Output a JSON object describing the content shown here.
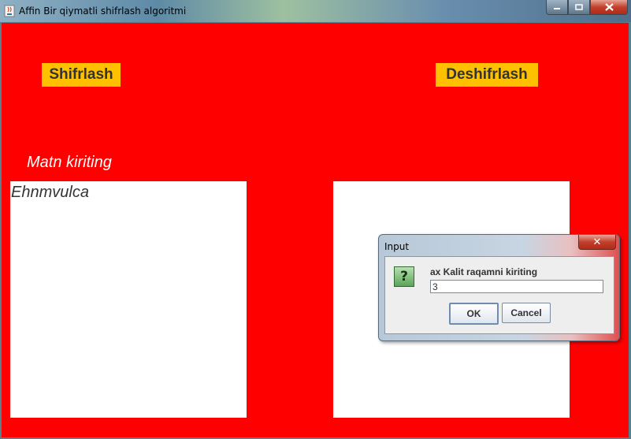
{
  "window": {
    "title": "Affin Bir qiymatli shifrlash algoritmi",
    "icon": "java-cup-icon",
    "controls": [
      "minimize-icon",
      "maximize-icon",
      "close-icon"
    ]
  },
  "main": {
    "encrypt_label": "Shifrlash",
    "decrypt_label": "Deshifrlash",
    "prompt_label": "Matn kiriting",
    "input_text": "Ehnmvulca",
    "output_text": "",
    "background_color": "#ff0000",
    "button_color": "#ffc000"
  },
  "dialog": {
    "title": "Input",
    "icon": "question-icon",
    "message": "ax Kalit raqamni kiriting",
    "value": "3",
    "ok_label": "OK",
    "cancel_label": "Cancel"
  }
}
